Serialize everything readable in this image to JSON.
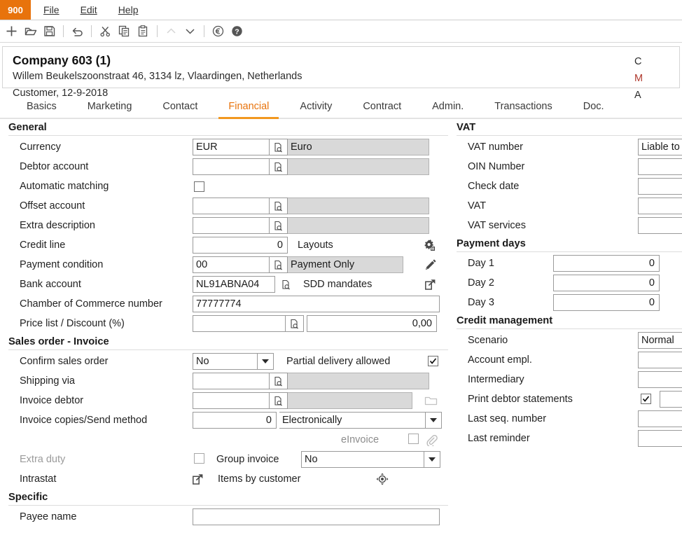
{
  "app": {
    "badge": "900",
    "menus": [
      "File",
      "Edit",
      "Help"
    ]
  },
  "toolbar": {
    "items": [
      {
        "name": "new-icon",
        "title": "New"
      },
      {
        "name": "open-folder-icon",
        "title": "Open"
      },
      {
        "name": "save-icon",
        "title": "Save"
      },
      {
        "name": "undo-icon",
        "title": "Undo"
      },
      {
        "name": "cut-icon",
        "title": "Cut"
      },
      {
        "name": "copy-icon",
        "title": "Copy"
      },
      {
        "name": "paste-icon",
        "title": "Paste"
      },
      {
        "name": "chevron-up-icon",
        "title": "Previous"
      },
      {
        "name": "chevron-down-icon",
        "title": "Next"
      },
      {
        "name": "euro-icon",
        "title": "Currency"
      },
      {
        "name": "help-icon",
        "title": "Help"
      }
    ]
  },
  "header": {
    "title": "Company 603 (1)",
    "address": "Willem Beukelszoonstraat 46, 3134 lz, Vlaardingen, Netherlands",
    "status": "Customer, 12-9-2018",
    "right_col": [
      "C",
      "M",
      "A"
    ]
  },
  "tabs": [
    {
      "label": "Basics",
      "active": false
    },
    {
      "label": "Marketing",
      "active": false
    },
    {
      "label": "Contact",
      "active": false
    },
    {
      "label": "Financial",
      "active": true
    },
    {
      "label": "Activity",
      "active": false
    },
    {
      "label": "Contract",
      "active": false
    },
    {
      "label": "Admin.",
      "active": false
    },
    {
      "label": "Transactions",
      "active": false
    },
    {
      "label": "Doc.",
      "active": false
    }
  ],
  "left": {
    "general": {
      "heading": "General",
      "currency": {
        "label": "Currency",
        "code": "EUR",
        "description": "Euro"
      },
      "debtor_account": {
        "label": "Debtor account",
        "code": "",
        "description": ""
      },
      "automatic_matching": {
        "label": "Automatic matching",
        "checked": false
      },
      "offset_account": {
        "label": "Offset account",
        "code": "",
        "description": ""
      },
      "extra_description": {
        "label": "Extra description",
        "code": "",
        "description": ""
      },
      "credit_line": {
        "label": "Credit line",
        "value": "0",
        "side_label": "Layouts"
      },
      "payment_condition": {
        "label": "Payment condition",
        "code": "00",
        "description": "Payment Only"
      },
      "bank_account": {
        "label": "Bank account",
        "value": "NL91ABNA04",
        "side_label": "SDD mandates"
      },
      "chamber_of_commerce": {
        "label": "Chamber of Commerce number",
        "value": "77777774"
      },
      "price_list_discount": {
        "label": "Price list / Discount (%)",
        "code": "",
        "value": "0,00"
      }
    },
    "sales_order": {
      "heading": "Sales order - Invoice",
      "confirm_sales_order": {
        "label": "Confirm sales order",
        "value": "No"
      },
      "partial_delivery": {
        "label": "Partial delivery allowed",
        "checked": true
      },
      "shipping_via": {
        "label": "Shipping via",
        "code": "",
        "description": ""
      },
      "invoice_debtor": {
        "label": "Invoice debtor",
        "code": "",
        "description": ""
      },
      "invoice_copies": {
        "label": "Invoice copies/Send method",
        "copies": "0",
        "method": "Electronically"
      },
      "einvoice": {
        "label": "eInvoice",
        "checked": false
      },
      "extra_duty": {
        "label": "Extra duty",
        "checked": false
      },
      "group_invoice": {
        "label": "Group invoice",
        "value": "No"
      },
      "intrastat": {
        "label": "Intrastat"
      },
      "items_by_customer": {
        "label": "Items by customer"
      }
    },
    "specific": {
      "heading": "Specific",
      "payee_name": {
        "label": "Payee name",
        "value": ""
      }
    }
  },
  "right": {
    "vat": {
      "heading": "VAT",
      "rows": [
        {
          "label": "VAT number",
          "value": "Liable to"
        },
        {
          "label": "OIN Number",
          "value": ""
        },
        {
          "label": "Check date",
          "value": ""
        },
        {
          "label": "VAT",
          "value": ""
        },
        {
          "label": "VAT services",
          "value": ""
        }
      ]
    },
    "payment_days": {
      "heading": "Payment days",
      "rows": [
        {
          "label": "Day 1",
          "value": "0"
        },
        {
          "label": "Day 2",
          "value": "0"
        },
        {
          "label": "Day 3",
          "value": "0"
        }
      ]
    },
    "credit_management": {
      "heading": "Credit management",
      "scenario": {
        "label": "Scenario",
        "value": "Normal"
      },
      "account_empl": {
        "label": "Account empl.",
        "value": ""
      },
      "intermediary": {
        "label": "Intermediary",
        "value": ""
      },
      "print_debtor_statements": {
        "label": "Print debtor statements",
        "checked": true
      },
      "last_seq_number": {
        "label": "Last seq. number",
        "value": ""
      },
      "last_reminder": {
        "label": "Last reminder",
        "value": ""
      }
    }
  },
  "colors": {
    "accent": "#e8730c",
    "tab_underline": "#f2981f",
    "readonly_bg": "#d9d9d9",
    "border": "#9a9a9a"
  }
}
